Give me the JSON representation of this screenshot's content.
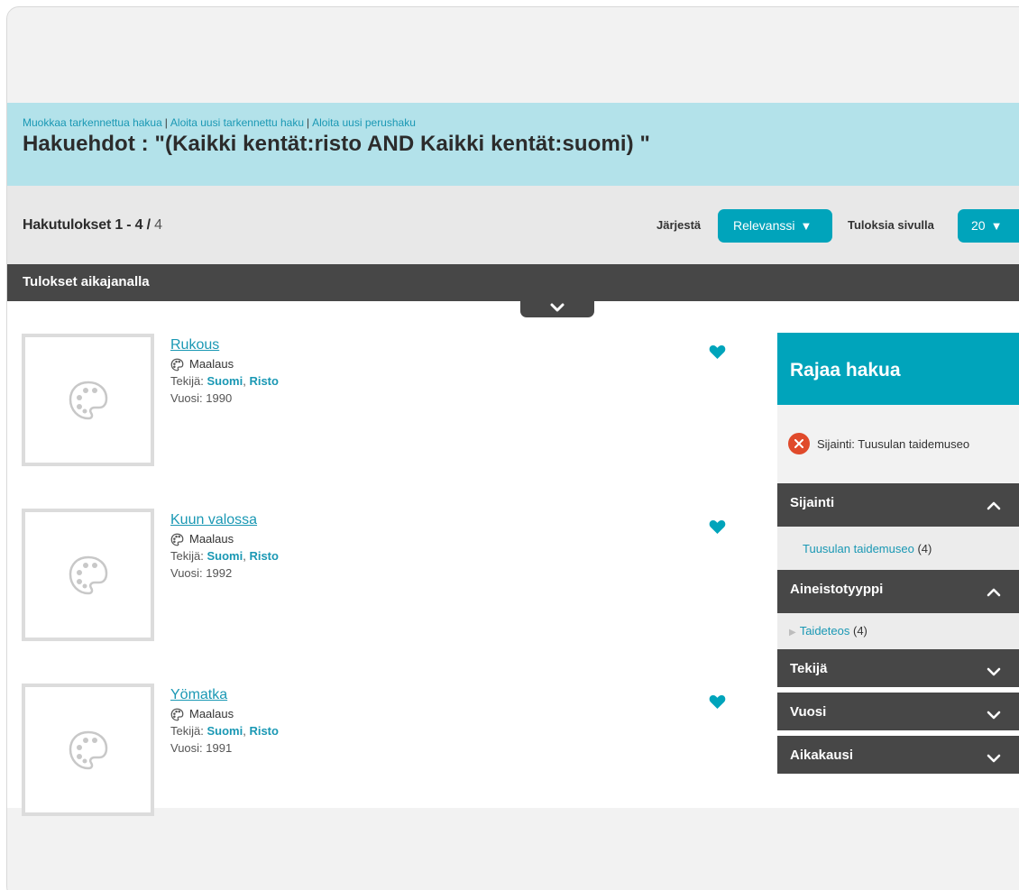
{
  "header": {
    "links": [
      "Muokkaa tarkennettua hakua",
      "Aloita uusi tarkennettu haku",
      "Aloita uusi perushaku"
    ],
    "separator": "|",
    "query_label": "Hakuehdot : \"(Kaikki kentät:risto AND Kaikki kentät:suomi) \""
  },
  "results_bar": {
    "label": "Hakutulokset 1 - 4",
    "slash": " / ",
    "total": "4",
    "sort_label": "Järjestä",
    "sort_value": "Relevanssi",
    "per_page_label": "Tuloksia sivulla",
    "per_page_value": "20"
  },
  "timeline": {
    "title": "Tulokset aikajanalla"
  },
  "labels": {
    "author": "Tekijä:",
    "year": "Vuosi:"
  },
  "results": [
    {
      "title": "Rukous",
      "format": "Maalaus",
      "author_last": "Suomi",
      "author_first": "Risto",
      "year": "1990"
    },
    {
      "title": "Kuun valossa",
      "format": "Maalaus",
      "author_last": "Suomi",
      "author_first": "Risto",
      "year": "1992"
    },
    {
      "title": "Yömatka",
      "format": "Maalaus",
      "author_last": "Suomi",
      "author_first": "Risto",
      "year": "1991"
    }
  ],
  "facets": {
    "title": "Rajaa hakua",
    "active_filter": "Sijainti: Tuusulan taidemuseo",
    "groups": [
      {
        "name": "Sijainti",
        "value": "Tuusulan taidemuseo",
        "count": "(4)"
      },
      {
        "name": "Aineistotyyppi",
        "value": "Taideteos",
        "count": "(4)"
      },
      {
        "name": "Tekijä"
      },
      {
        "name": "Vuosi"
      },
      {
        "name": "Aikakausi"
      }
    ]
  },
  "colors": {
    "accent": "#00a4bb",
    "header_bg": "#b3e2ea",
    "dark_bar": "#474747",
    "remove": "#e04a2b"
  }
}
